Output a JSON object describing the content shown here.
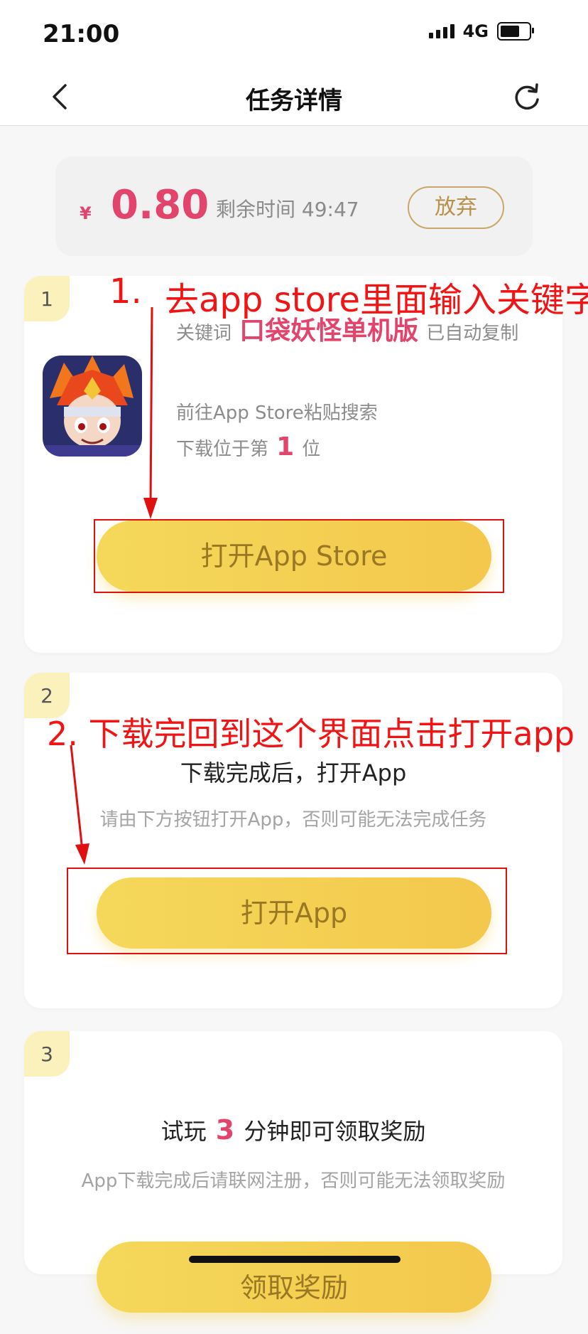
{
  "status_bar": {
    "time": "21:00",
    "network": "4G"
  },
  "nav": {
    "title": "任务详情"
  },
  "reward": {
    "currency": "¥",
    "amount": "0.80",
    "time_label": "剩余时间 49:47",
    "give_up_label": "放弃"
  },
  "step1": {
    "number": "1",
    "keyword_prefix": "关键词",
    "keyword": "口袋妖怪单机版",
    "keyword_suffix": "已自动复制",
    "instruction": "前往App Store粘贴搜索",
    "rank_prefix": "下载位于第",
    "rank": "1",
    "rank_suffix": "位",
    "button_label": "打开App Store",
    "annotation_num": "1.",
    "annotation_text": "去app store里面输入关键字"
  },
  "step2": {
    "number": "2",
    "heading": "下载完成后，打开App",
    "note": "请由下方按钮打开App，否则可能无法完成任务",
    "button_label": "打开App",
    "annotation_text": "2. 下载完回到这个界面点击打开app"
  },
  "step3": {
    "number": "3",
    "heading_prefix": "试玩",
    "minutes": "3",
    "heading_suffix": "分钟即可领取奖励",
    "note": "App下载完成后请联网注册，否则可能无法领取奖励",
    "button_label": "领取奖励"
  },
  "colors": {
    "accent": "#e2446b",
    "button": "#f5d85a",
    "annotation": "#f21414",
    "gold_text": "#9a7722"
  }
}
